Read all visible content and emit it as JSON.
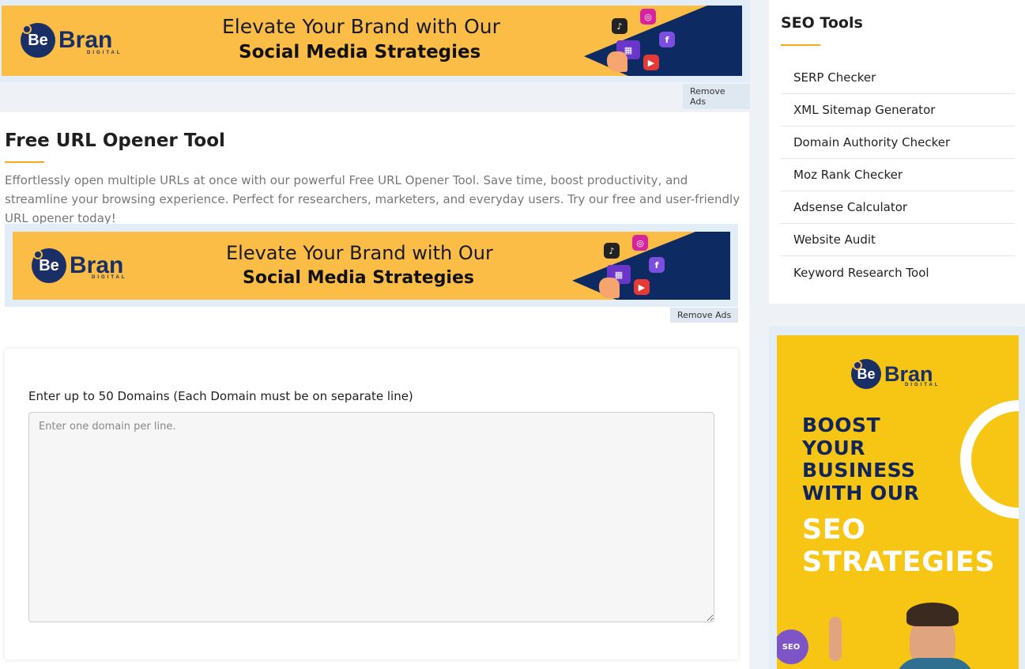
{
  "top_ad": {
    "logo_mark": "Be",
    "logo_name": "Bran",
    "logo_sub": "DIGITAL",
    "tagline_1": "Elevate Your Brand with Our",
    "tagline_2": "Social Media Strategies",
    "remove_ads": "Remove Ads"
  },
  "main": {
    "title": "Free URL Opener Tool",
    "intro": "Effortlessly open multiple URLs at once with our powerful Free URL Opener Tool. Save time, boost productivity, and streamline your browsing experience. Perfect for researchers, marketers, and everyday users. Try our free and user-friendly URL opener today!"
  },
  "inline_ad": {
    "logo_mark": "Be",
    "logo_name": "Bran",
    "logo_sub": "DIGITAL",
    "tagline_1": "Elevate Your Brand with Our",
    "tagline_2": "Social Media Strategies",
    "remove_ads": "Remove Ads"
  },
  "form": {
    "label": "Enter up to 50 Domains (Each Domain must be on separate line)",
    "textarea_value": "",
    "textarea_placeholder": "Enter one domain per line."
  },
  "sidebar": {
    "title": "SEO Tools",
    "items": [
      {
        "label": "SERP Checker"
      },
      {
        "label": "XML Sitemap Generator"
      },
      {
        "label": "Domain Authority Checker"
      },
      {
        "label": "Moz Rank Checker"
      },
      {
        "label": "Adsense Calculator"
      },
      {
        "label": "Website Audit"
      },
      {
        "label": "Keyword Research Tool"
      }
    ]
  },
  "side_ad": {
    "logo_mark": "Be",
    "logo_name": "Bran",
    "logo_sub": "DIGITAL",
    "headline_1": "BOOST",
    "headline_2": "YOUR",
    "headline_3": "BUSINESS",
    "headline_4": "WITH OUR",
    "highlight_1": "SEO",
    "highlight_2": "STRATEGIES",
    "gear_label": "SEO"
  },
  "colors": {
    "accent": "#f7a81b",
    "banner_yellow": "#fbbd45",
    "side_ad_yellow": "#f7c614",
    "navy": "#12255b",
    "page_bg": "#eef1f5"
  },
  "icons": {
    "social": [
      "tiktok-icon",
      "instagram-icon",
      "facebook-icon",
      "youtube-icon"
    ],
    "textarea_resize": "resize-grip-icon"
  }
}
